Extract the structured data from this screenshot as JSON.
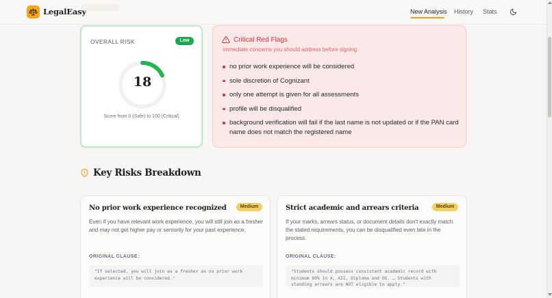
{
  "app": {
    "name": "LegalEasy"
  },
  "nav": {
    "items": [
      "New Analysis",
      "History",
      "Stats"
    ],
    "active": "New Analysis"
  },
  "colors": {
    "accent": "#f0a21f",
    "low": "#1ea650",
    "danger": "#d9303a",
    "medium": "#f2cf66"
  },
  "risk": {
    "title": "OVERALL RISK",
    "badge": "Low",
    "score": "18",
    "score_value": 18,
    "caption": "Score from 0 (Safe) to 100 (Critical)"
  },
  "red_flags": {
    "title": "Critical Red Flags",
    "subtitle": "Immediate concerns you should address before signing.",
    "items": [
      "no prior work experience will be considered",
      "sole discretion of Cognizant",
      "only one attempt is given for all assessments",
      "profile will be disqualified",
      "background verification will fail if the last name is not updated or if the PAN card name does not match the registered name"
    ]
  },
  "breakdown": {
    "title": "Key Risks Breakdown",
    "clause_label": "ORIGINAL CLAUSE:",
    "cards": [
      {
        "title": "No prior work experience recognized",
        "severity": "Medium",
        "description": "Even if you have relevant work experience, you will still join as a fresher and may not get higher pay or seniority for your past experience.",
        "clause": "\"If selected, you will join as a fresher as no prior work experience will be considered.\""
      },
      {
        "title": "Strict academic and arrears criteria",
        "severity": "Medium",
        "description": "If your marks, arrears status, or document details don't exactly match the stated requirements, you can be disqualified even late in the process.",
        "clause": "\"Students should possess consistent academic record with minimum 60% in X, XII, Diploma and UG. … Students with standing arrears are NOT eligible to apply.\""
      }
    ]
  }
}
